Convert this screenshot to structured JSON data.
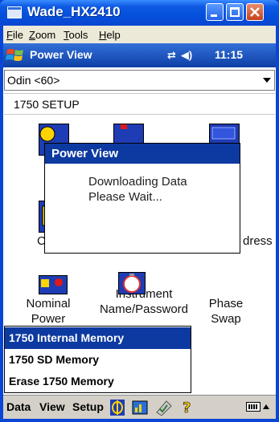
{
  "window": {
    "title": "Wade_HX2410"
  },
  "menubar": {
    "items": [
      "File",
      "Zoom",
      "Tools",
      "Help"
    ]
  },
  "navbar": {
    "title": "Power View",
    "time": "11:15"
  },
  "device_select": {
    "value": "Odin <60>"
  },
  "section": {
    "title": "1750 SETUP"
  },
  "icons": [
    {
      "label": "Clock"
    },
    {
      "label": "Address"
    },
    {
      "label_line1": "Nominal",
      "label_line2": "Power"
    },
    {
      "label_line1": "Instrument",
      "label_line2": "Name/Password"
    },
    {
      "label_line1": "Phase",
      "label_line2": "Swap"
    }
  ],
  "visible_icon_labels": {
    "clock_fragment": "Cl",
    "address_fragment": "dress"
  },
  "dialog": {
    "title": "Power View",
    "line1": "Downloading Data",
    "line2": "Please Wait..."
  },
  "popup_menu": {
    "items": [
      "1750 Internal Memory",
      "1750 SD Memory",
      "Erase 1750 Memory"
    ],
    "selected_index": 0
  },
  "command_bar": {
    "data": "Data",
    "view": "View",
    "setup": "Setup"
  },
  "colors": {
    "titlebar": "#0a46d6",
    "navbar": "#0d3fa6",
    "dialog_title": "#0d3aa0",
    "selection": "#0d3aa0"
  }
}
